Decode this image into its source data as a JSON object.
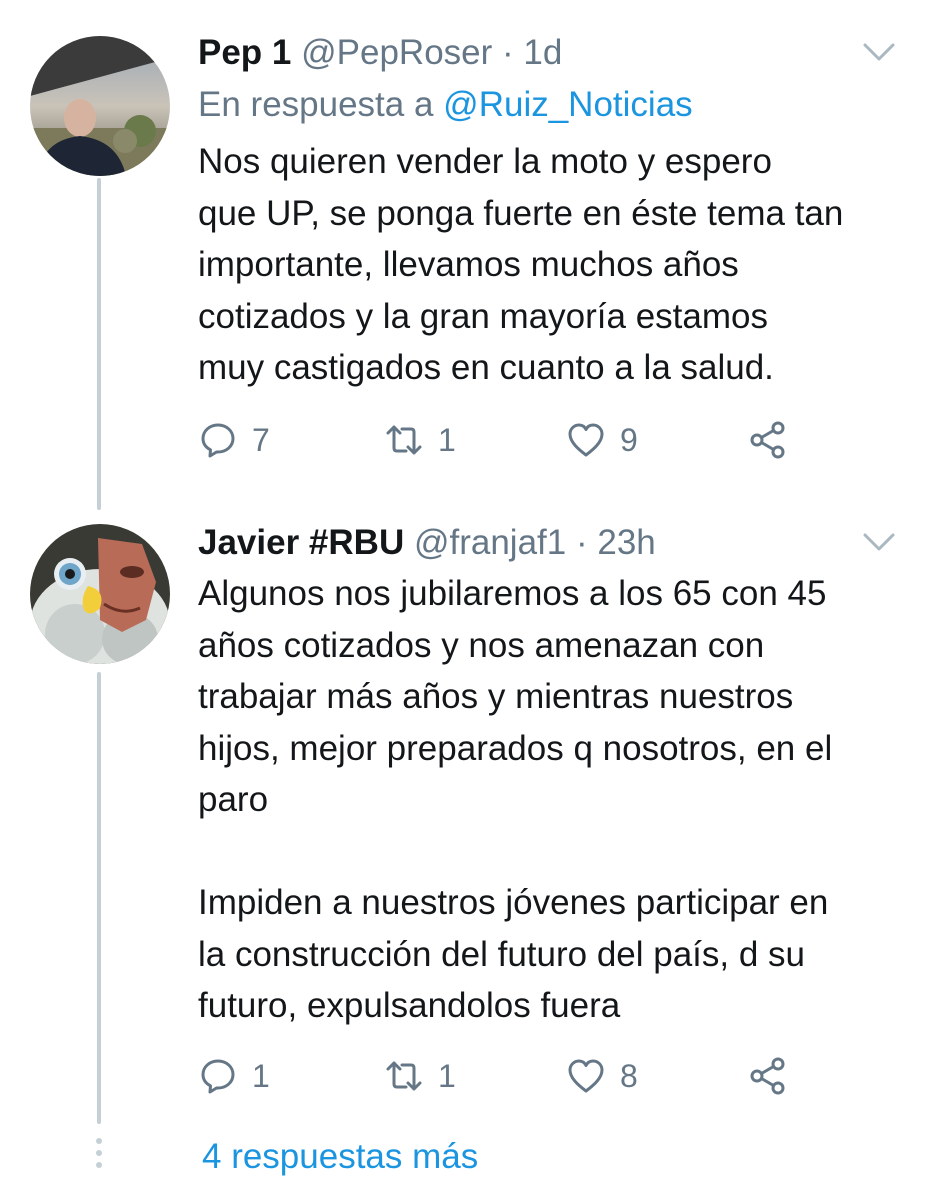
{
  "tweets": [
    {
      "name": "Pep 1",
      "handle": "@PepRoser",
      "separator": "·",
      "time": "1d",
      "reply_prefix": "En respuesta a",
      "reply_mention": "@Ruiz_Noticias",
      "text": "Nos quieren vender la moto y espero\nque UP, se ponga fuerte en éste tema tan\nimportante, llevamos muchos años\ncotizados y la gran mayoría estamos\nmuy castigados en cuanto a la salud.",
      "replies": "7",
      "retweets": "1",
      "likes": "9"
    },
    {
      "name": "Javier #RBU",
      "handle": "@franjaf1",
      "separator": "·",
      "time": "23h",
      "text": "Algunos nos jubilaremos a los 65 con 45\naños cotizados y nos amenazan con\ntrabajar más años y mientras nuestros\nhijos, mejor preparados q nosotros, en el\nparo\n\nImpiden a nuestros jóvenes participar en\nla construcción del futuro del país, d su\nfuturo, expulsandolos fuera",
      "replies": "1",
      "retweets": "1",
      "likes": "8"
    }
  ],
  "more_replies": "4 respuestas más",
  "icons": {
    "reply": "reply-icon",
    "retweet": "retweet-icon",
    "like": "heart-icon",
    "share": "share-icon",
    "caret": "chevron-down-icon"
  },
  "colors": {
    "link": "#1b95e0",
    "muted": "#657786",
    "thread_line": "#c4cfd6"
  }
}
